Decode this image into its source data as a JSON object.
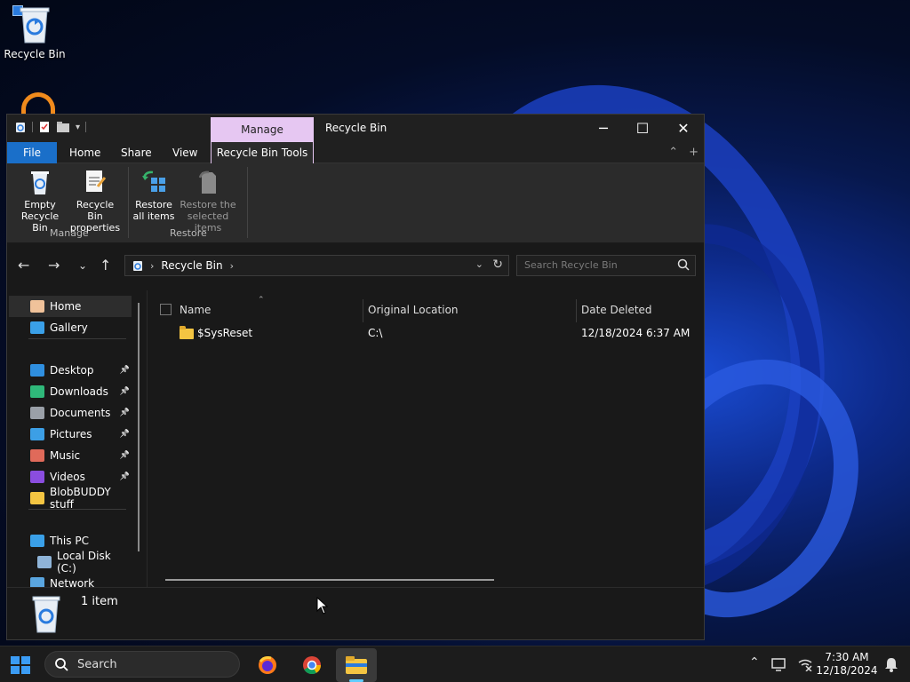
{
  "desktop": {
    "recycle_bin_label": "Recycle Bin"
  },
  "window": {
    "title": "Recycle Bin",
    "contextual_tab_group": "Manage",
    "ribbon_tabs": [
      "File",
      "Home",
      "Share",
      "View",
      "Recycle Bin Tools"
    ],
    "ribbon": {
      "empty_recycle_bin": "Empty\nRecycle Bin",
      "recycle_bin_properties": "Recycle Bin\nproperties",
      "restore_all_items": "Restore\nall items",
      "restore_selected_items": "Restore the\nselected items",
      "group_manage": "Manage",
      "group_restore": "Restore"
    },
    "address": {
      "crumb": "Recycle Bin",
      "search_placeholder": "Search Recycle Bin"
    },
    "sidebar": {
      "items": [
        {
          "label": "Home",
          "icon": "home-icon",
          "color": "#f0c29a",
          "pinned": false
        },
        {
          "label": "Gallery",
          "icon": "gallery-icon",
          "color": "#3aa0e8",
          "pinned": false
        },
        {
          "label": "Desktop",
          "icon": "desktop-icon",
          "color": "#2f8fe0",
          "pinned": true
        },
        {
          "label": "Downloads",
          "icon": "download-icon",
          "color": "#2fb87a",
          "pinned": true
        },
        {
          "label": "Documents",
          "icon": "documents-icon",
          "color": "#9aa0a8",
          "pinned": true
        },
        {
          "label": "Pictures",
          "icon": "pictures-icon",
          "color": "#3c9fe6",
          "pinned": true
        },
        {
          "label": "Music",
          "icon": "music-icon",
          "color": "#e06a5a",
          "pinned": true
        },
        {
          "label": "Videos",
          "icon": "videos-icon",
          "color": "#8a4de0",
          "pinned": true
        },
        {
          "label": "BlobBUDDY stuff",
          "icon": "folder-icon",
          "color": "#f4c542",
          "pinned": false
        },
        {
          "label": "This PC",
          "icon": "pc-icon",
          "color": "#3aa0e8",
          "pinned": false
        },
        {
          "label": "Local Disk (C:)",
          "icon": "disk-icon",
          "color": "#8fb4d8",
          "pinned": false
        },
        {
          "label": "Network",
          "icon": "network-icon",
          "color": "#5aa6e0",
          "pinned": false
        }
      ]
    },
    "columns": [
      "Name",
      "Original Location",
      "Date Deleted"
    ],
    "files": [
      {
        "name": "$SysReset",
        "location": "C:\\",
        "date_deleted": "12/18/2024 6:37 AM"
      }
    ],
    "status": {
      "item_count": "1 item"
    }
  },
  "taskbar": {
    "search_placeholder": "Search",
    "time": "7:30 AM",
    "date": "12/18/2024"
  },
  "colors": {
    "accent": "#1a6fc9",
    "manage_tab": "#e6c7f2",
    "folder": "#f4c542"
  }
}
